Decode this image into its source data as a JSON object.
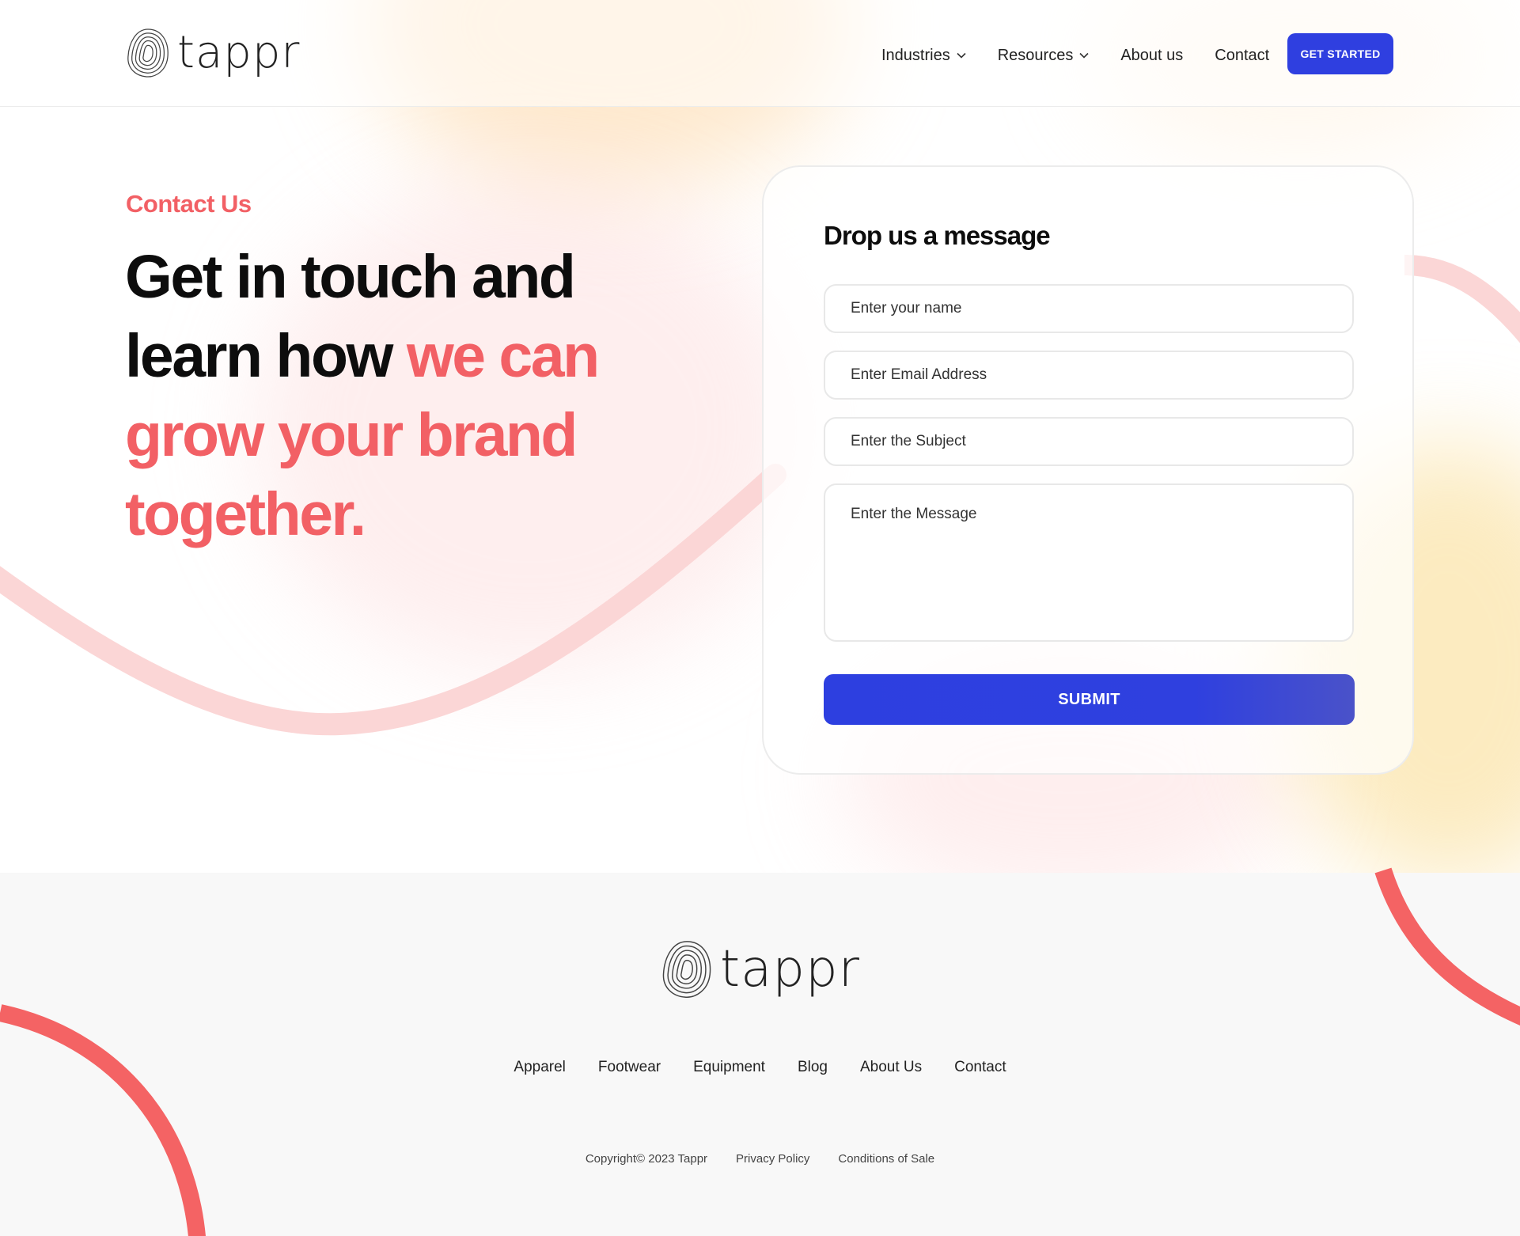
{
  "brand": {
    "name": "tappr"
  },
  "nav": {
    "items": [
      {
        "label": "Industries",
        "dropdown": true
      },
      {
        "label": "Resources",
        "dropdown": true
      },
      {
        "label": "About us",
        "dropdown": false
      },
      {
        "label": "Contact",
        "dropdown": false
      }
    ],
    "cta_label": "GET STARTED"
  },
  "hero": {
    "eyebrow": "Contact Us",
    "headline_plain": "Get in touch and learn how",
    "headline_accent": "we can grow your brand together."
  },
  "form": {
    "title": "Drop us a message",
    "name_placeholder": "Enter your name",
    "email_placeholder": "Enter Email Address",
    "subject_placeholder": "Enter the Subject",
    "message_placeholder": "Enter the Message",
    "submit_label": "SUBMIT"
  },
  "footer": {
    "links": [
      "Apparel",
      "Footwear",
      "Equipment",
      "Blog",
      "About Us",
      "Contact"
    ],
    "copyright": "Copyright© 2023 Tappr",
    "privacy": "Privacy Policy",
    "conditions": "Conditions of Sale"
  },
  "colors": {
    "accent": "#f26065",
    "primary_button": "#2f3fe0",
    "curve_light": "#fbd6d6",
    "curve_strong": "#f46364",
    "footer_bg": "#f8f8f8"
  }
}
